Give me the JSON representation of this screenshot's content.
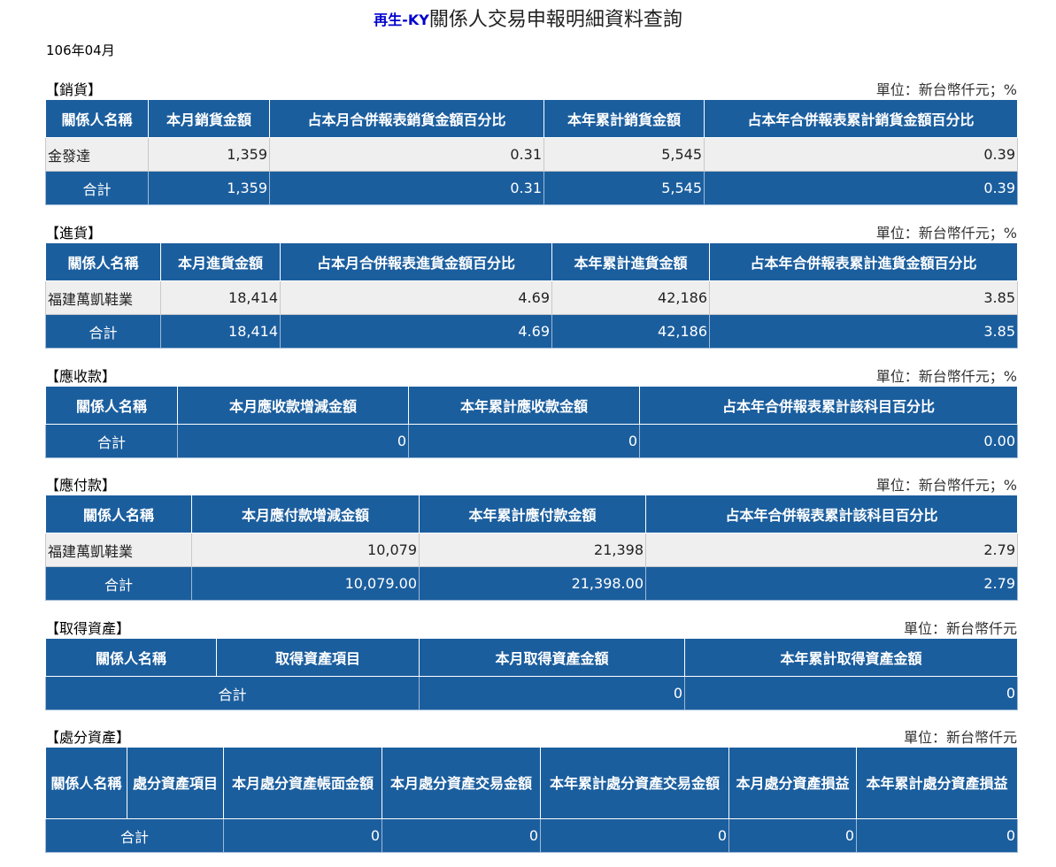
{
  "header": {
    "company": "再生-KY",
    "title": "關係人交易申報明細資料查詢",
    "date": "106年04月"
  },
  "sales": {
    "label": "【銷貨】",
    "unit": "單位：新台幣仟元；%",
    "columns": [
      "關係人名稱",
      "本月銷貨金額",
      "占本月合併報表銷貨金額百分比",
      "本年累計銷貨金額",
      "占本年合併報表累計銷貨金額百分比"
    ],
    "rows": [
      [
        "金發達",
        "1,359",
        "0.31",
        "5,545",
        "0.39"
      ]
    ],
    "total": [
      "合計",
      "1,359",
      "0.31",
      "5,545",
      "0.39"
    ]
  },
  "purchases": {
    "label": "【進貨】",
    "unit": "單位：新台幣仟元；%",
    "columns": [
      "關係人名稱",
      "本月進貨金額",
      "占本月合併報表進貨金額百分比",
      "本年累計進貨金額",
      "占本年合併報表累計進貨金額百分比"
    ],
    "rows": [
      [
        "福建萬凱鞋業",
        "18,414",
        "4.69",
        "42,186",
        "3.85"
      ]
    ],
    "total": [
      "合計",
      "18,414",
      "4.69",
      "42,186",
      "3.85"
    ]
  },
  "receivables": {
    "label": "【應收款】",
    "unit": "單位：新台幣仟元；%",
    "columns": [
      "關係人名稱",
      "本月應收款增減金額",
      "本年累計應收款金額",
      "占本年合併報表累計該科目百分比"
    ],
    "rows": [],
    "total": [
      "合計",
      "0",
      "0",
      "0.00"
    ]
  },
  "payables": {
    "label": "【應付款】",
    "unit": "單位：新台幣仟元；%",
    "columns": [
      "關係人名稱",
      "本月應付款增減金額",
      "本年累計應付款金額",
      "占本年合併報表累計該科目百分比"
    ],
    "rows": [
      [
        "福建萬凱鞋業",
        "10,079",
        "21,398",
        "2.79"
      ]
    ],
    "total": [
      "合計",
      "10,079.00",
      "21,398.00",
      "2.79"
    ]
  },
  "acquisitions": {
    "label": "【取得資產】",
    "unit": "單位：新台幣仟元",
    "columns": [
      "關係人名稱",
      "取得資產項目",
      "本月取得資產金額",
      "本年累計取得資產金額"
    ],
    "total": [
      "合計",
      "0",
      "0"
    ]
  },
  "disposals": {
    "label": "【處分資產】",
    "unit": "單位：新台幣仟元",
    "columns": [
      "關係人名稱",
      "處分資產項目",
      "本月處分資產帳面金額",
      "本月處分資產交易金額",
      "本年累計處分資產交易金額",
      "本月處分資產損益",
      "本年累計處分資產損益"
    ],
    "total": [
      "合計",
      "0",
      "0",
      "0",
      "0",
      "0"
    ]
  }
}
